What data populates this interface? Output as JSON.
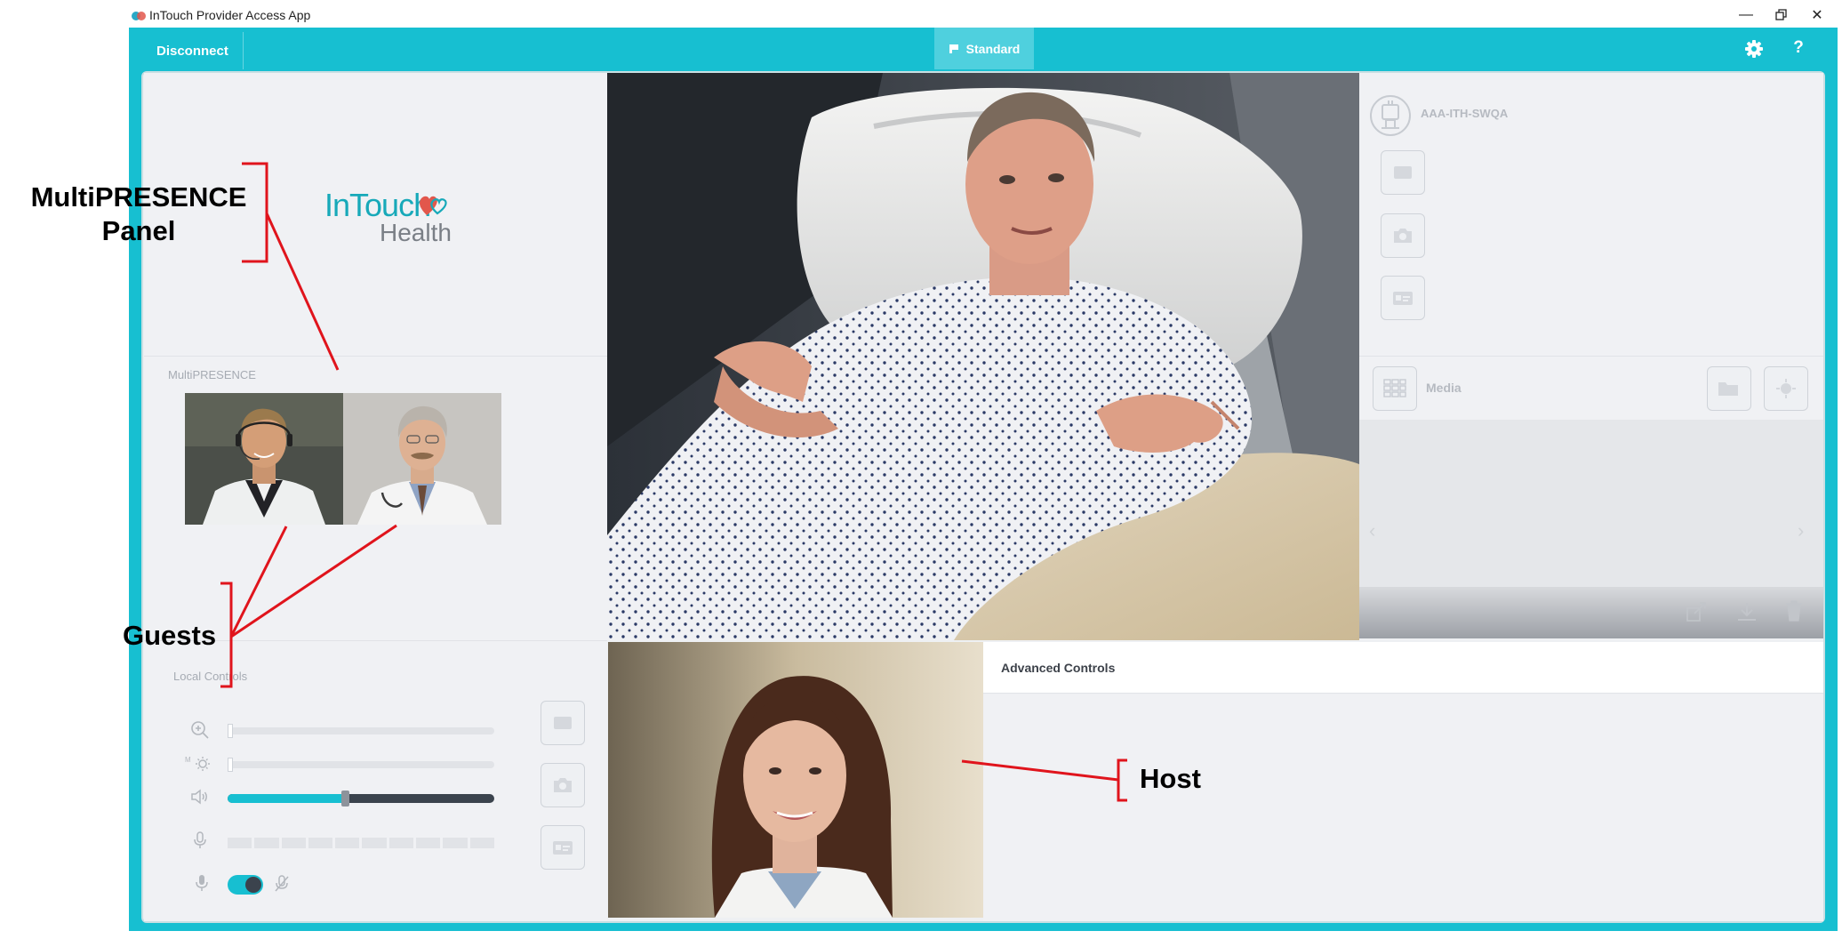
{
  "window": {
    "title": "InTouch Provider Access App",
    "controls": [
      "minimize",
      "restore",
      "close"
    ]
  },
  "toolbar": {
    "disconnect_label": "Disconnect",
    "mode_label": "Standard",
    "help_label": "?"
  },
  "left_panel": {
    "logo": {
      "line1": "InTouch",
      "line2": "Health"
    },
    "multipresence_title": "MultiPRESENCE",
    "local_controls_title": "Local Controls",
    "guests": [
      "guest-1",
      "guest-2"
    ],
    "volume_level": 0.44
  },
  "right_panel": {
    "device_name": "AAA-ITH-SWQA",
    "media_label": "Media"
  },
  "advanced_controls_label": "Advanced Controls",
  "annotations": {
    "panel_line1": "MultiPRESENCE",
    "panel_line2": "Panel",
    "guests": "Guests",
    "host": "Host"
  },
  "colors": {
    "frame": "#17bfd1",
    "accent": "#17bfd1",
    "annotation": "#e0141c"
  }
}
